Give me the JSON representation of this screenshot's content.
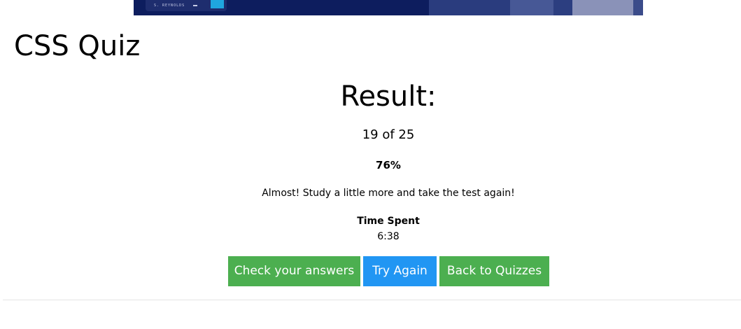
{
  "banner": {
    "card_name": "S. REYNOLDS",
    "colors": {
      "background": "#0d1d5e",
      "card": "#1e2d6e",
      "logo": "#1fa6df"
    }
  },
  "page": {
    "title": "CSS Quiz"
  },
  "result": {
    "heading": "Result:",
    "score": "19 of 25",
    "percent": "76%",
    "message": "Almost! Study a little more and take the test again!",
    "time_label": "Time Spent",
    "time_value": "6:38"
  },
  "actions": {
    "check_answers": "Check your answers",
    "try_again": "Try Again",
    "back_to_quizzes": "Back to Quizzes"
  },
  "colors": {
    "green_button": "#4caf50",
    "blue_button": "#2196f3"
  }
}
